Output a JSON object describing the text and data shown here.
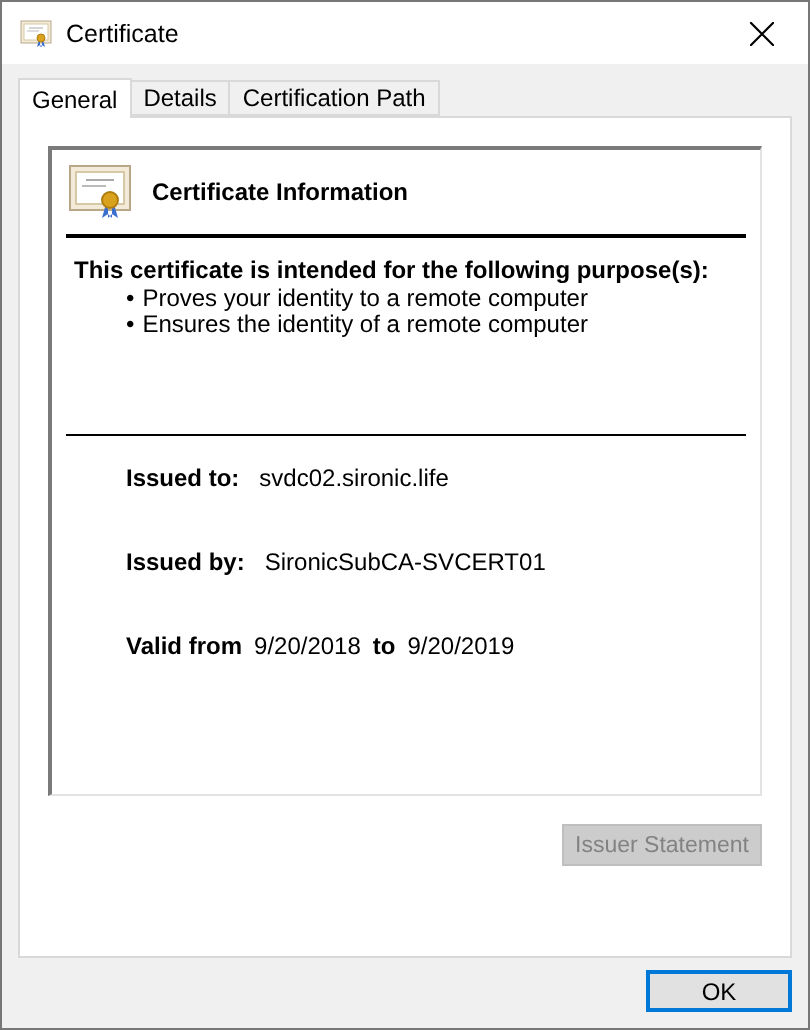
{
  "window": {
    "title": "Certificate"
  },
  "tabs": [
    {
      "label": "General",
      "selected": true
    },
    {
      "label": "Details",
      "selected": false
    },
    {
      "label": "Certification Path",
      "selected": false
    }
  ],
  "info": {
    "title": "Certificate Information",
    "purpose_heading": "This certificate is intended for the following purpose(s):",
    "bullet": "•",
    "purposes": [
      "Proves your identity to a remote computer",
      "Ensures the identity of a remote computer"
    ],
    "issued_to": {
      "label": "Issued to:",
      "value": "svdc02.sironic.life"
    },
    "issued_by": {
      "label": "Issued by:",
      "value": "SironicSubCA-SVCERT01"
    },
    "validity": {
      "label": "Valid from",
      "from": "9/20/2018",
      "to_label": "to",
      "to": "9/20/2019"
    }
  },
  "issuer_statement": {
    "label": "Issuer Statement",
    "disabled": true
  },
  "buttons": [
    "OK"
  ]
}
